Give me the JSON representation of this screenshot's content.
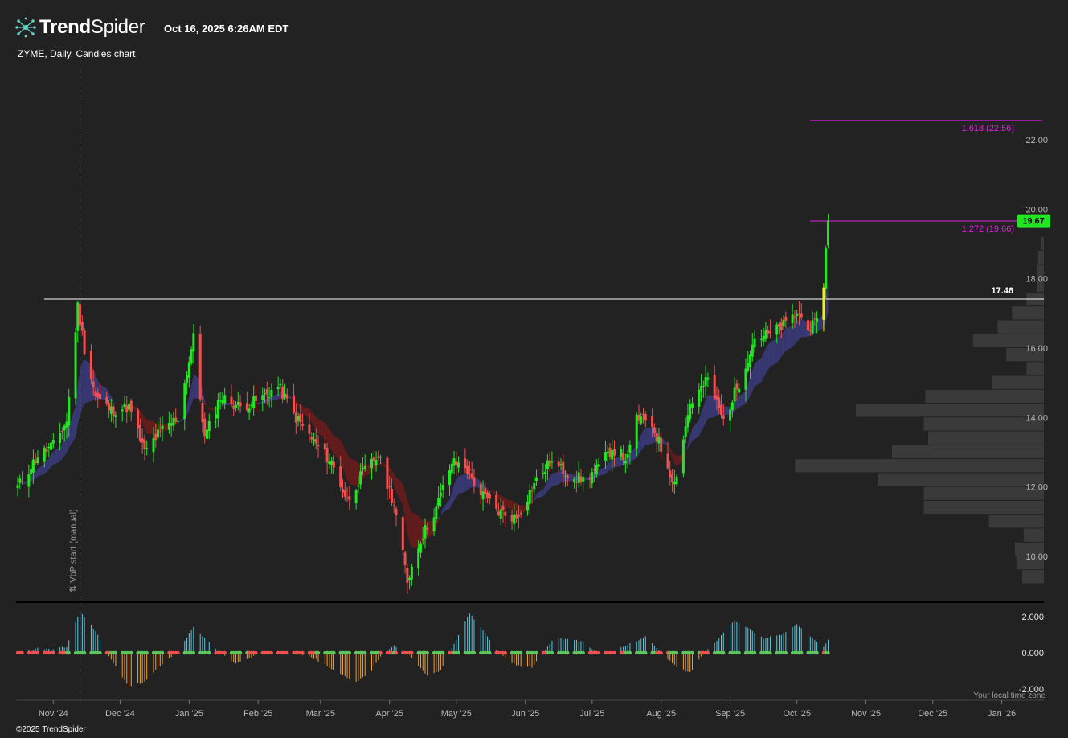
{
  "header": {
    "brand_part1": "Trend",
    "brand_part2": "Spider",
    "timestamp": "Oct 16, 2025 6:26AM EDT"
  },
  "chart_subtitle": "ZYME, Daily, Candles chart",
  "footer": {
    "copyright": "©2025 TrendSpider",
    "timezone_note": "Your local time zone"
  },
  "colors": {
    "background": "#222222",
    "up_candle": "#22e622",
    "down_candle": "#f05050",
    "highlight_candle": "#f2f20a",
    "fib_lines": "#e020e0",
    "ma_band_bull": "#3a3a7a",
    "ma_band_bear": "#6a1c1c",
    "osc_positive": "#5ac8e0",
    "osc_negative": "#f0a030",
    "volume_profile": "#3a3a3a"
  },
  "chart_data": {
    "type": "candlestick",
    "symbol": "ZYME",
    "timeframe": "Daily",
    "ylim": [
      9.0,
      23.0
    ],
    "y_ticks": [
      "10.00",
      "12.00",
      "14.00",
      "16.00",
      "18.00",
      "20.00",
      "22.00"
    ],
    "x_ticks": [
      "Nov '24",
      "Dec '24",
      "Jan '25",
      "Feb '25",
      "Mar '25",
      "Apr '25",
      "May '25",
      "Jun '25",
      "Jul '25",
      "Aug '25",
      "Sep '25",
      "Oct '25",
      "Nov '25",
      "Dec '25",
      "Jan '26"
    ],
    "vbp_marker_label": "⇅ VbP start (manual)",
    "horizontal_level": {
      "value": 17.46,
      "label": "17.46"
    },
    "fib_levels": [
      {
        "label": "1.618 (22.56)",
        "value": 22.56
      },
      {
        "label": "1.272 (19.66)",
        "value": 19.66
      }
    ],
    "last_price": {
      "value": 19.67,
      "label": "19.67"
    },
    "price_anchors": [
      [
        "2024-10-16",
        12.0
      ],
      [
        "2024-10-25",
        12.9
      ],
      [
        "2024-11-01",
        13.2
      ],
      [
        "2024-11-07",
        13.9
      ],
      [
        "2024-11-12",
        17.2
      ],
      [
        "2024-11-15",
        16.0
      ],
      [
        "2024-11-20",
        14.6
      ],
      [
        "2024-11-27",
        14.2
      ],
      [
        "2024-12-05",
        14.3
      ],
      [
        "2024-12-12",
        13.0
      ],
      [
        "2024-12-19",
        13.6
      ],
      [
        "2024-12-27",
        14.0
      ],
      [
        "2025-01-03",
        16.3
      ],
      [
        "2025-01-08",
        13.4
      ],
      [
        "2025-01-15",
        14.6
      ],
      [
        "2025-01-24",
        14.3
      ],
      [
        "2025-02-01",
        14.5
      ],
      [
        "2025-02-10",
        14.9
      ],
      [
        "2025-02-18",
        14.0
      ],
      [
        "2025-02-26",
        13.3
      ],
      [
        "2025-03-06",
        12.7
      ],
      [
        "2025-03-13",
        11.6
      ],
      [
        "2025-03-20",
        12.4
      ],
      [
        "2025-03-27",
        12.9
      ],
      [
        "2025-04-03",
        11.5
      ],
      [
        "2025-04-09",
        9.3
      ],
      [
        "2025-04-15",
        10.5
      ],
      [
        "2025-04-22",
        11.4
      ],
      [
        "2025-04-29",
        12.7
      ],
      [
        "2025-05-05",
        12.6
      ],
      [
        "2025-05-12",
        11.8
      ],
      [
        "2025-05-20",
        11.3
      ],
      [
        "2025-05-28",
        11.1
      ],
      [
        "2025-06-05",
        12.1
      ],
      [
        "2025-06-12",
        12.7
      ],
      [
        "2025-06-20",
        12.4
      ],
      [
        "2025-06-27",
        12.2
      ],
      [
        "2025-07-03",
        12.5
      ],
      [
        "2025-07-10",
        13.1
      ],
      [
        "2025-07-17",
        12.8
      ],
      [
        "2025-07-21",
        14.0
      ],
      [
        "2025-07-28",
        13.8
      ],
      [
        "2025-08-04",
        12.6
      ],
      [
        "2025-08-07",
        12.1
      ],
      [
        "2025-08-14",
        14.4
      ],
      [
        "2025-08-22",
        15.1
      ],
      [
        "2025-08-29",
        13.9
      ],
      [
        "2025-09-05",
        15.0
      ],
      [
        "2025-09-12",
        16.3
      ],
      [
        "2025-09-19",
        16.4
      ],
      [
        "2025-09-26",
        16.7
      ],
      [
        "2025-10-01",
        17.0
      ],
      [
        "2025-10-07",
        16.6
      ],
      [
        "2025-10-10",
        16.7
      ],
      [
        "2025-10-13",
        17.9
      ],
      [
        "2025-10-15",
        19.67
      ]
    ],
    "volume_profile": [
      {
        "price": 9.4,
        "rel": 0.15
      },
      {
        "price": 9.8,
        "rel": 0.19
      },
      {
        "price": 10.2,
        "rel": 0.2
      },
      {
        "price": 10.6,
        "rel": 0.14
      },
      {
        "price": 11.0,
        "rel": 0.38
      },
      {
        "price": 11.4,
        "rel": 0.83
      },
      {
        "price": 11.8,
        "rel": 0.83
      },
      {
        "price": 12.2,
        "rel": 1.15
      },
      {
        "price": 12.6,
        "rel": 1.72
      },
      {
        "price": 13.0,
        "rel": 1.05
      },
      {
        "price": 13.4,
        "rel": 0.8
      },
      {
        "price": 13.8,
        "rel": 0.83
      },
      {
        "price": 14.2,
        "rel": 1.3
      },
      {
        "price": 14.6,
        "rel": 0.82
      },
      {
        "price": 15.0,
        "rel": 0.36
      },
      {
        "price": 15.4,
        "rel": 0.12
      },
      {
        "price": 15.8,
        "rel": 0.26
      },
      {
        "price": 16.2,
        "rel": 0.49
      },
      {
        "price": 16.6,
        "rel": 0.32
      },
      {
        "price": 17.0,
        "rel": 0.22
      },
      {
        "price": 17.4,
        "rel": 0.12
      },
      {
        "price": 17.8,
        "rel": 0.05
      },
      {
        "price": 18.2,
        "rel": 0.05
      },
      {
        "price": 18.6,
        "rel": 0.04
      },
      {
        "price": 19.0,
        "rel": 0.02
      }
    ],
    "oscillator": {
      "ylim": [
        -2.0,
        2.0
      ],
      "y_ticks": [
        "2.000",
        "0.000",
        "-2.000"
      ],
      "anchors": [
        [
          "2024-10-16",
          0.0
        ],
        [
          "2024-10-25",
          0.25
        ],
        [
          "2024-11-01",
          0.2
        ],
        [
          "2024-11-07",
          0.35
        ],
        [
          "2024-11-13",
          2.3
        ],
        [
          "2024-11-20",
          1.2
        ],
        [
          "2024-11-25",
          0.0
        ],
        [
          "2024-12-05",
          -1.9
        ],
        [
          "2024-12-12",
          -1.6
        ],
        [
          "2024-12-20",
          -0.6
        ],
        [
          "2024-12-26",
          0.0
        ],
        [
          "2025-01-03",
          1.4
        ],
        [
          "2025-01-10",
          0.6
        ],
        [
          "2025-01-15",
          0.0
        ],
        [
          "2025-01-22",
          -0.6
        ],
        [
          "2025-01-28",
          -0.3
        ],
        [
          "2025-02-03",
          0.0
        ],
        [
          "2025-02-18",
          0.0
        ],
        [
          "2025-02-26",
          -0.3
        ],
        [
          "2025-03-10",
          -1.2
        ],
        [
          "2025-03-17",
          -1.6
        ],
        [
          "2025-03-24",
          -1.0
        ],
        [
          "2025-03-28",
          -0.2
        ],
        [
          "2025-04-03",
          0.4
        ],
        [
          "2025-04-09",
          0.0
        ],
        [
          "2025-04-18",
          -1.3
        ],
        [
          "2025-04-24",
          -1.0
        ],
        [
          "2025-04-28",
          0.0
        ],
        [
          "2025-05-07",
          2.2
        ],
        [
          "2025-05-15",
          0.9
        ],
        [
          "2025-05-20",
          0.0
        ],
        [
          "2025-05-28",
          -0.7
        ],
        [
          "2025-06-04",
          -0.8
        ],
        [
          "2025-06-09",
          0.0
        ],
        [
          "2025-06-13",
          0.7
        ],
        [
          "2025-06-20",
          0.8
        ],
        [
          "2025-06-27",
          0.6
        ],
        [
          "2025-07-03",
          0.0
        ],
        [
          "2025-07-10",
          0.0
        ],
        [
          "2025-07-16",
          0.4
        ],
        [
          "2025-07-25",
          0.9
        ],
        [
          "2025-08-01",
          0.0
        ],
        [
          "2025-08-08",
          -0.8
        ],
        [
          "2025-08-14",
          -1.1
        ],
        [
          "2025-08-20",
          0.0
        ],
        [
          "2025-08-26",
          0.7
        ],
        [
          "2025-09-03",
          1.8
        ],
        [
          "2025-09-10",
          1.3
        ],
        [
          "2025-09-16",
          0.8
        ],
        [
          "2025-09-24",
          1.0
        ],
        [
          "2025-10-01",
          1.6
        ],
        [
          "2025-10-08",
          0.8
        ],
        [
          "2025-10-13",
          0.3
        ],
        [
          "2025-10-15",
          0.7
        ]
      ]
    }
  }
}
